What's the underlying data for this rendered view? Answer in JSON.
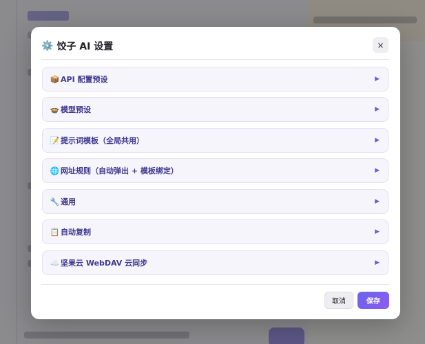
{
  "modal": {
    "title_icon": "⚙️",
    "title": "饺子 AI 设置",
    "close_label": "×"
  },
  "sections": [
    {
      "icon": "📦",
      "icon_name": "package-icon",
      "label": "API 配置预设"
    },
    {
      "icon": "🍲",
      "icon_name": "pot-icon",
      "label": "模型预设"
    },
    {
      "icon": "📝",
      "icon_name": "memo-icon",
      "label": "提示词模板（全局共用）"
    },
    {
      "icon": "🌐",
      "icon_name": "globe-icon",
      "label": "网址规则（自动弹出 + 模板绑定）"
    },
    {
      "icon": "🔧",
      "icon_name": "wrench-icon",
      "label": "通用"
    },
    {
      "icon": "📋",
      "icon_name": "clipboard-icon",
      "label": "自动复制"
    },
    {
      "icon": "☁️",
      "icon_name": "cloud-icon",
      "label": "坚果云 WebDAV 云同步"
    }
  ],
  "section_arrow": "▶",
  "footer": {
    "cancel_label": "取消",
    "save_label": "保存"
  },
  "colors": {
    "accent": "#6c63ee",
    "section_bg": "#f6f5fc",
    "section_text": "#3f3a8f"
  }
}
